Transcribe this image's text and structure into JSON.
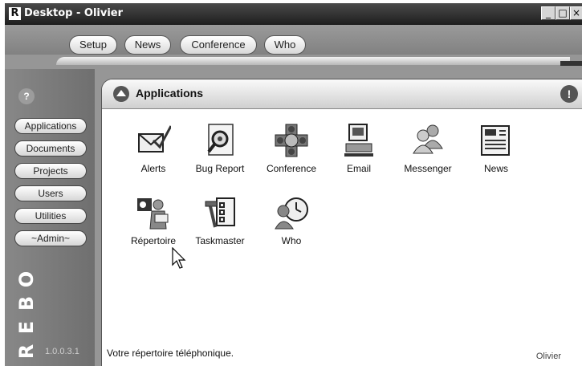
{
  "window": {
    "title": "Desktop - Olivier",
    "logo_letter": "R",
    "min": "_",
    "max": "□",
    "close": "×"
  },
  "top_nav": [
    "Setup",
    "News",
    "Conference",
    "Who"
  ],
  "sidebar": {
    "help": "?",
    "items": [
      "Applications",
      "Documents",
      "Projects",
      "Users",
      "Utilities",
      "~Admin~"
    ],
    "brand_letters": [
      "R",
      "E",
      "B",
      "O"
    ],
    "version": "1.0.0.3.1"
  },
  "panel": {
    "title": "Applications",
    "info": "!",
    "apps": [
      {
        "label": "Alerts",
        "icon": "envelope-check-icon"
      },
      {
        "label": "Bug Report",
        "icon": "magnifier-bug-icon"
      },
      {
        "label": "Conference",
        "icon": "conference-icon"
      },
      {
        "label": "Email",
        "icon": "computer-mail-icon"
      },
      {
        "label": "Messenger",
        "icon": "people-icon"
      },
      {
        "label": "News",
        "icon": "newspaper-icon"
      },
      {
        "label": "Répertoire",
        "icon": "person-directory-icon"
      },
      {
        "label": "Taskmaster",
        "icon": "checklist-hammer-icon"
      },
      {
        "label": "Who",
        "icon": "person-clock-icon"
      }
    ]
  },
  "status": {
    "text": "Votre répertoire téléphonique.",
    "user": "Olivier"
  }
}
